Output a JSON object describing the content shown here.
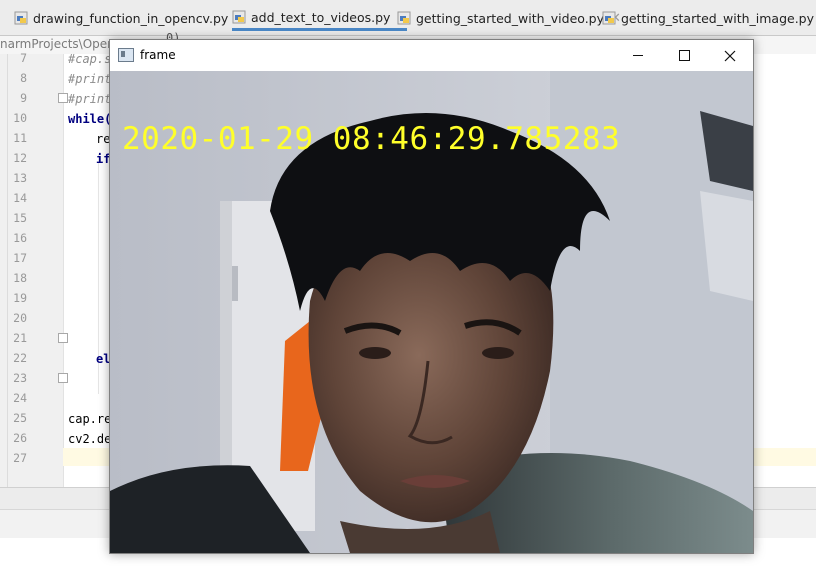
{
  "tabs": [
    {
      "label": "drawing_function_in_opencv.py",
      "active": false
    },
    {
      "label": "add_text_to_videos.py",
      "active": true
    },
    {
      "label": "getting_started_with_video.py",
      "active": false
    },
    {
      "label": "getting_started_with_image.py",
      "active": false
    }
  ],
  "breadcrumb": {
    "left": "narmProjects\\OpenC",
    "right": "0)"
  },
  "editor": {
    "line_numbers": [
      "7",
      "8",
      "9",
      "10",
      "11",
      "12",
      "13",
      "14",
      "15",
      "16",
      "17",
      "18",
      "19",
      "20",
      "21",
      "22",
      "23",
      "24",
      "25",
      "26",
      "27"
    ],
    "code": {
      "l7": "#cap.s",
      "l8": "#print",
      "l9": "#print",
      "l10": "while(",
      "l11": "re",
      "l12": "if",
      "l22": "el",
      "l25": "cap.re",
      "l26": "cv2.de"
    }
  },
  "window": {
    "title": "frame",
    "overlay_text": "2020-01-29 08:46:29.785283",
    "overlay_color": "#ffff2a"
  }
}
